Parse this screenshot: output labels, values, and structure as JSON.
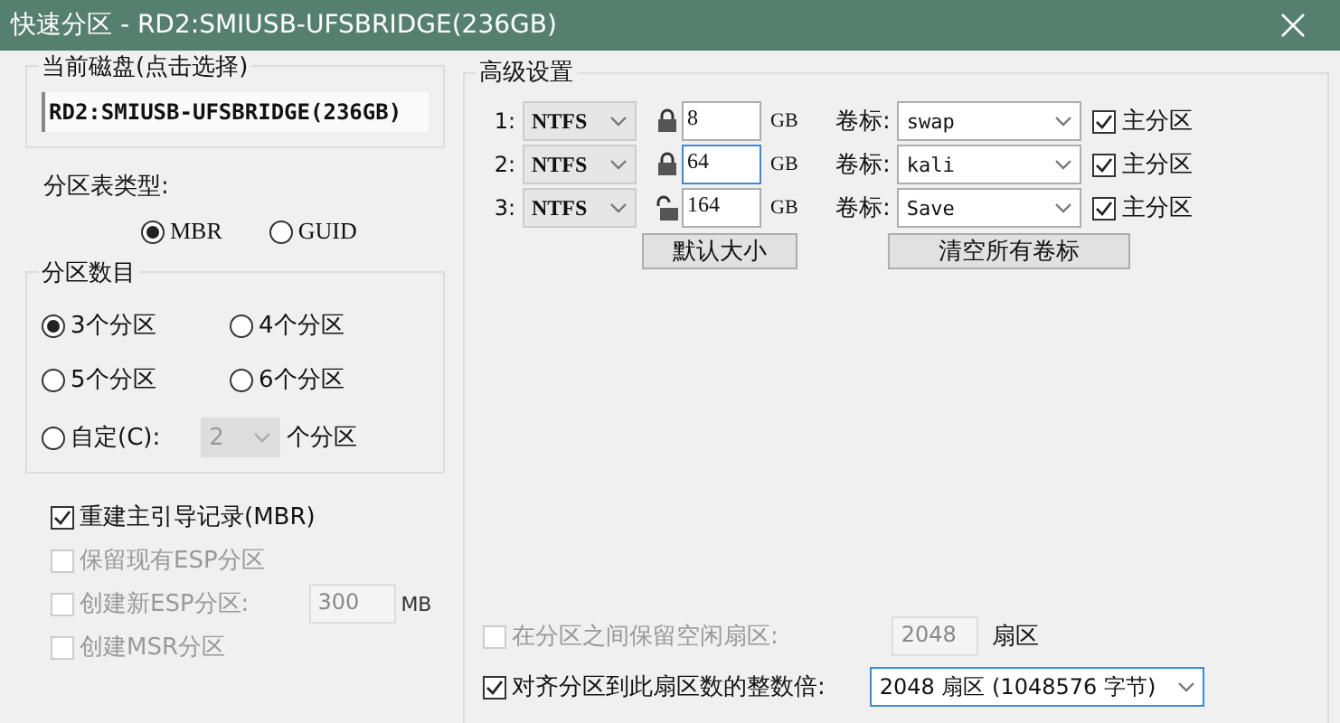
{
  "window": {
    "title": "快速分区 - RD2:SMIUSB-UFSBRIDGE(236GB)"
  },
  "current_disk": {
    "label": "当前磁盘(点击选择)",
    "value": "RD2:SMIUSB-UFSBRIDGE(236GB)"
  },
  "partition_table": {
    "label": "分区表类型:",
    "options": [
      {
        "label": "MBR",
        "selected": true
      },
      {
        "label": "GUID",
        "selected": false
      }
    ]
  },
  "partition_count": {
    "label": "分区数目",
    "options": [
      {
        "label": "3个分区",
        "selected": true
      },
      {
        "label": "4个分区",
        "selected": false
      },
      {
        "label": "5个分区",
        "selected": false
      },
      {
        "label": "6个分区",
        "selected": false
      }
    ],
    "custom": {
      "label": "自定(C):",
      "selected": false,
      "value": "2",
      "disabled": true,
      "suffix": "个分区"
    }
  },
  "options": [
    {
      "label": "重建主引导记录(MBR)",
      "checked": true,
      "disabled": false
    },
    {
      "label": "保留现有ESP分区",
      "checked": false,
      "disabled": true
    },
    {
      "label": "创建新ESP分区:",
      "checked": false,
      "disabled": true,
      "value": "300",
      "unit": "MB"
    },
    {
      "label": "创建MSR分区",
      "checked": false,
      "disabled": true
    }
  ],
  "advanced": {
    "title": "高级设置",
    "partitions": [
      {
        "index": "1:",
        "fs": "NTFS",
        "locked": true,
        "size": "8",
        "focused": false,
        "unit": "GB",
        "volume_caption": "卷标:",
        "volume": "swap",
        "primary_label": "主分区",
        "primary": true
      },
      {
        "index": "2:",
        "fs": "NTFS",
        "locked": true,
        "size": "64",
        "focused": true,
        "unit": "GB",
        "volume_caption": "卷标:",
        "volume": "kali",
        "primary_label": "主分区",
        "primary": true
      },
      {
        "index": "3:",
        "fs": "NTFS",
        "locked": false,
        "size": "164",
        "focused": false,
        "unit": "GB",
        "volume_caption": "卷标:",
        "volume": "Save",
        "primary_label": "主分区",
        "primary": true
      }
    ],
    "buttons": [
      "默认大小",
      "清空所有卷标"
    ],
    "free_sectors": {
      "label": "在分区之间保留空闲扇区:",
      "checked": false,
      "disabled": true,
      "value": "2048",
      "unit": "扇区"
    },
    "align": {
      "label": "对齐分区到此扇区数的整数倍:",
      "checked": true,
      "value": "2048 扇区 (1048576 字节)"
    }
  }
}
